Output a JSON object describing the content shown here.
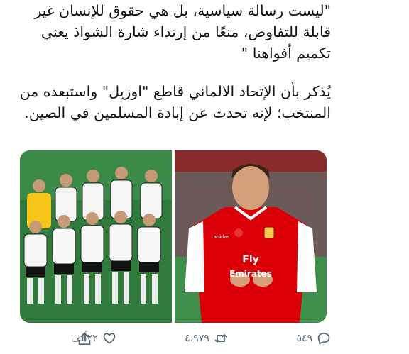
{
  "tweet": {
    "paragraphs": [
      "\"ليست رسالة سياسية، بل هي حقوق للإنسان غير قابلة للتفاوض، منعًا من إرتداء شارة الشواذ يعني تكميم أفواهنا \"",
      "يُذكر بأن الإتحاد الالماني قاطع \"اوزيل\" واستبعده من المنتخب؛ لإنه تحدث عن إبادة المسلمين في الصين."
    ]
  },
  "media": {
    "photo_right": {
      "shirt_text_1": "Fly",
      "shirt_text_2": "Emirates",
      "brand": "adidas"
    }
  },
  "actions": {
    "replies": "٥٤٩",
    "retweets": "٤،٩٧٩",
    "likes": "٢٢ألف"
  },
  "colors": {
    "action_gray": "#536471",
    "arsenal_red": "#db0007"
  }
}
